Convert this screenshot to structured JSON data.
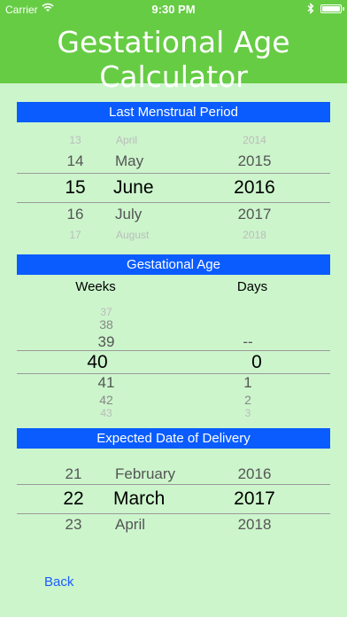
{
  "status": {
    "carrier": "Carrier",
    "time": "9:30 PM"
  },
  "header": {
    "title": "Gestational Age Calculator"
  },
  "lmp": {
    "label": "Last Menstrual Period",
    "day": {
      "above2": "13",
      "above1": "14",
      "selected": "15",
      "below1": "16",
      "below2": "17"
    },
    "month": {
      "above2": "April",
      "above1": "May",
      "selected": "June",
      "below1": "July",
      "below2": "August"
    },
    "year": {
      "above2": "2014",
      "above1": "2015",
      "selected": "2016",
      "below1": "2017",
      "below2": "2018"
    }
  },
  "ga": {
    "label": "Gestational Age",
    "weeks_label": "Weeks",
    "days_label": "Days",
    "weeks": {
      "above3": "37",
      "above2": "38",
      "above1": "39",
      "selected": "40",
      "below1": "41",
      "below2": "42",
      "below3": "43"
    },
    "days": {
      "above1": "--",
      "selected": "0",
      "below1": "1",
      "below2": "2",
      "below3": "3"
    }
  },
  "edd": {
    "label": "Expected Date of Delivery",
    "day": {
      "above1": "21",
      "selected": "22",
      "below1": "23"
    },
    "month": {
      "above1": "February",
      "selected": "March",
      "below1": "April"
    },
    "year": {
      "above1": "2016",
      "selected": "2017",
      "below1": "2018"
    }
  },
  "nav": {
    "back_label": "Back"
  }
}
